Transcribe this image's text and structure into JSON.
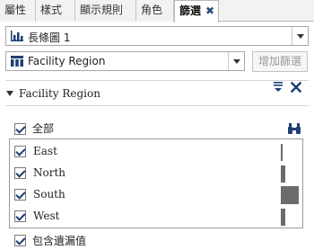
{
  "tabs": [
    {
      "label": "屬性",
      "active": false
    },
    {
      "label": "樣式",
      "active": false
    },
    {
      "label": "顯示規則",
      "active": false
    },
    {
      "label": "角色",
      "active": false
    },
    {
      "label": "篩選",
      "active": true
    }
  ],
  "tab_close_glyph": "✖",
  "object_select": {
    "value": "長條圖 1",
    "icon": "bar-chart-icon"
  },
  "data_item_select": {
    "value": "Facility Region",
    "icon": "category-icon"
  },
  "add_filter_button": {
    "label": "增加篩選",
    "enabled": false
  },
  "filter": {
    "title": "Facility Region",
    "select_all_label": "全部",
    "select_all_checked": true,
    "values": [
      {
        "label": "East",
        "checked": true,
        "frequency": 0.1
      },
      {
        "label": "North",
        "checked": true,
        "frequency": 0.25
      },
      {
        "label": "South",
        "checked": true,
        "frequency": 1.0
      },
      {
        "label": "West",
        "checked": true,
        "frequency": 0.25
      }
    ],
    "include_missing_label": "包含遺漏值",
    "include_missing_checked": true
  },
  "colors": {
    "accent": "#1f3e73",
    "bar": "#6b6b6b"
  }
}
